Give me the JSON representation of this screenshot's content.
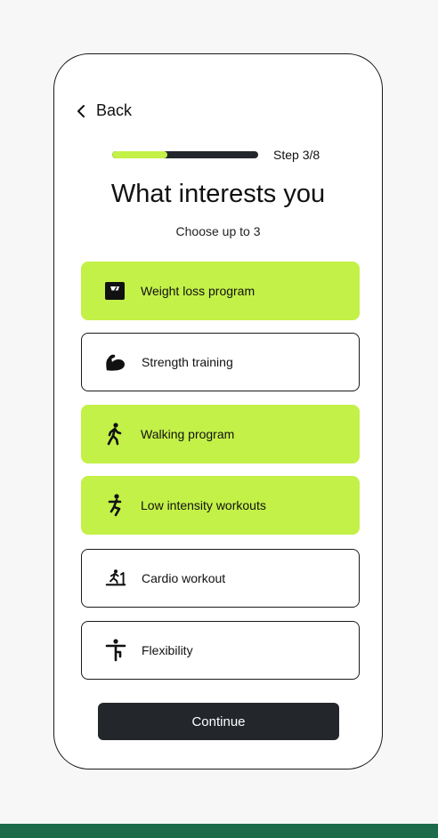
{
  "colors": {
    "page_background": "#f7f7f7",
    "accent": "#c3f148",
    "dark": "#23262b",
    "footer_band": "#1d6b4b"
  },
  "header": {
    "back_label": "Back",
    "back_icon": "chevron-left-icon",
    "step_label": "Step 3/8",
    "progress_fraction": 0.375
  },
  "main": {
    "title": "What interests you",
    "subtitle": "Choose up to 3",
    "options": [
      {
        "label": "Weight loss program",
        "icon": "scale-icon",
        "selected": true
      },
      {
        "label": "Strength training",
        "icon": "flexed-arm-icon",
        "selected": false
      },
      {
        "label": "Walking program",
        "icon": "walking-person-icon",
        "selected": true
      },
      {
        "label": "Low intensity workouts",
        "icon": "squat-person-icon",
        "selected": true
      },
      {
        "label": "Cardio workout",
        "icon": "treadmill-icon",
        "selected": false
      },
      {
        "label": "Flexibility",
        "icon": "stretching-person-icon",
        "selected": false
      }
    ]
  },
  "footer": {
    "continue_label": "Continue"
  }
}
